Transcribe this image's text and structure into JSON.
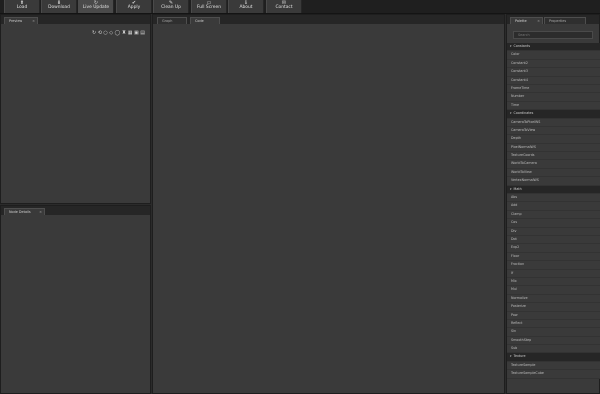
{
  "toolbar": {
    "buttons": [
      {
        "label": "Load",
        "icon": "upload-icon",
        "glyph": "⬆"
      },
      {
        "label": "Download",
        "icon": "download-icon",
        "glyph": "⬇"
      },
      {
        "label": "Live Update",
        "icon": "refresh-icon",
        "glyph": "↻"
      },
      {
        "label": "Apply",
        "icon": "check-icon",
        "glyph": "✔"
      },
      {
        "label": "Clean Up",
        "icon": "brush-icon",
        "glyph": "✎"
      },
      {
        "label": "Full Screen",
        "icon": "monitor-icon",
        "glyph": "▭"
      },
      {
        "label": "About",
        "icon": "info-icon",
        "glyph": "ℹ"
      },
      {
        "label": "Contact",
        "icon": "mail-icon",
        "glyph": "✉"
      }
    ]
  },
  "preview_panel": {
    "tab_label": "Preview",
    "close_glyph": "×",
    "icons": [
      {
        "name": "reload-icon",
        "glyph": "↻"
      },
      {
        "name": "rotate-icon",
        "glyph": "⟲"
      },
      {
        "name": "sphere-icon",
        "glyph": "○"
      },
      {
        "name": "cube-icon",
        "glyph": "◇"
      },
      {
        "name": "circle-icon",
        "glyph": "◯"
      },
      {
        "name": "teapot-icon",
        "glyph": "♜"
      },
      {
        "name": "grid-icon",
        "glyph": "▦"
      },
      {
        "name": "image-icon",
        "glyph": "▣"
      },
      {
        "name": "folder-icon",
        "glyph": "▤"
      }
    ]
  },
  "node_details_panel": {
    "tab_label": "Node Details",
    "close_glyph": "×"
  },
  "editor_panel": {
    "tabs": [
      "Graph",
      "Code"
    ]
  },
  "right_panel": {
    "tabs": [
      "Palette",
      "Properties"
    ],
    "close_glyph": "×",
    "search_placeholder": "Search",
    "categories": [
      {
        "name": "Constants",
        "items": [
          "Color",
          "Constant2",
          "Constant3",
          "Constant4",
          "FrameTime",
          "Number",
          "Time"
        ]
      },
      {
        "name": "Coordinates",
        "items": [
          "CameraToPixelWS",
          "CameraToView",
          "Depth",
          "PixelNormalWS",
          "TextureCoords",
          "WorldToCamera",
          "WorldToView",
          "VertexNormalWS"
        ]
      },
      {
        "name": "Math",
        "items": [
          "Abs",
          "Add",
          "Clamp",
          "Cos",
          "Div",
          "Dot",
          "Exp2",
          "Floor",
          "Fraction",
          "If",
          "Mix",
          "Mul",
          "Normalize",
          "Posterize",
          "Pow",
          "Reflect",
          "Sin",
          "SmoothStep",
          "Sub"
        ]
      },
      {
        "name": "Texture",
        "items": [
          "TextureSample",
          "TextureSampleCube"
        ]
      }
    ]
  }
}
